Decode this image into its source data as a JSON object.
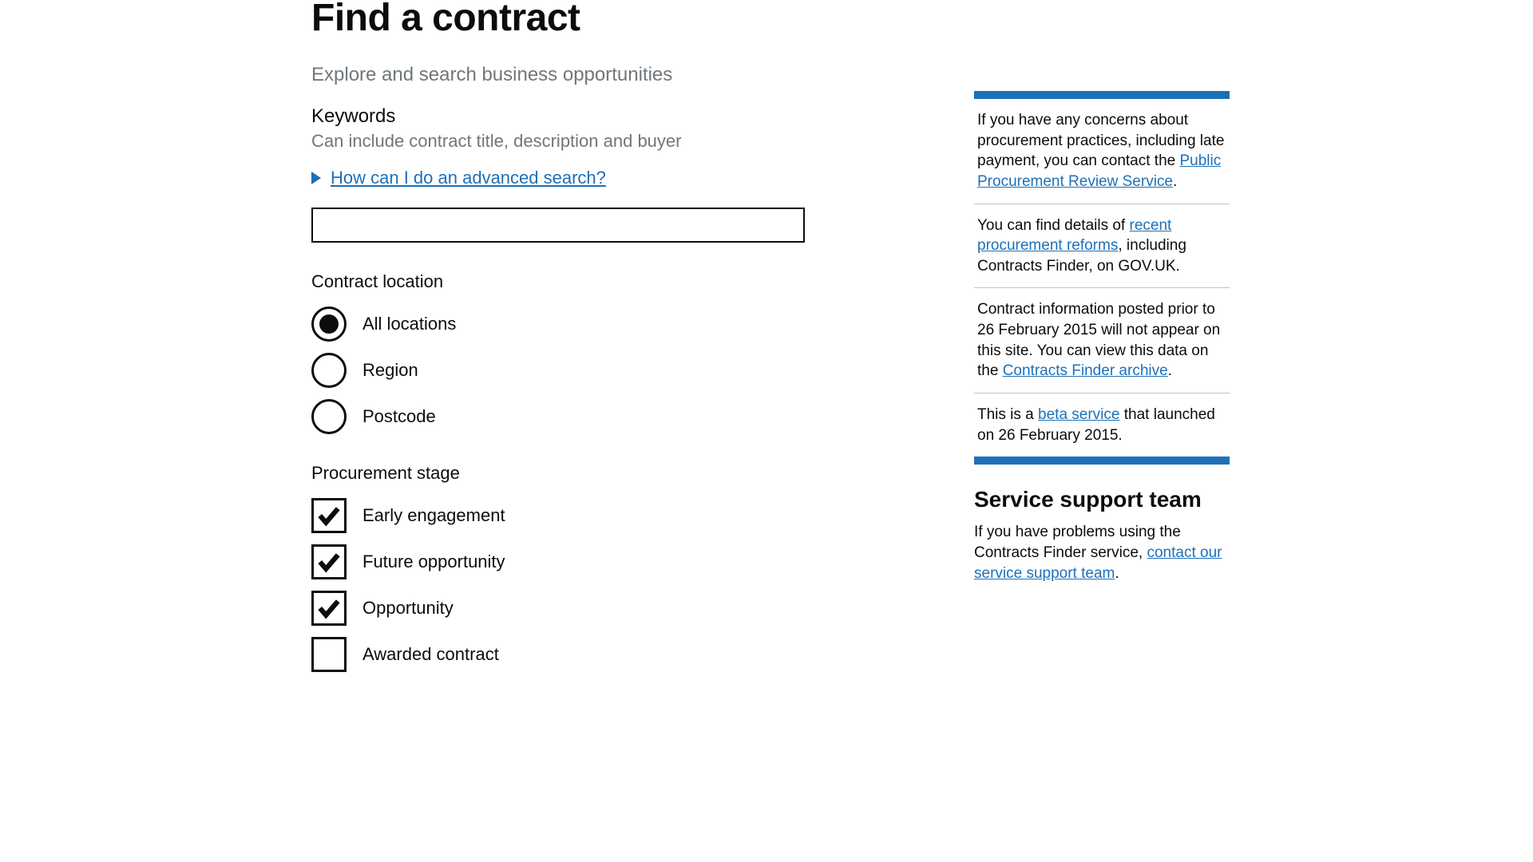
{
  "page": {
    "title": "Find a contract",
    "lede": "Explore and search business opportunities"
  },
  "keywords": {
    "label": "Keywords",
    "hint": "Can include contract title, description and buyer",
    "advanced_link": "How can I do an advanced search?",
    "value": ""
  },
  "location": {
    "legend": "Contract location",
    "options": [
      {
        "label": "All locations",
        "checked": true
      },
      {
        "label": "Region",
        "checked": false
      },
      {
        "label": "Postcode",
        "checked": false
      }
    ]
  },
  "stage": {
    "legend": "Procurement stage",
    "options": [
      {
        "label": "Early engagement",
        "checked": true
      },
      {
        "label": "Future opportunity",
        "checked": true
      },
      {
        "label": "Opportunity",
        "checked": true
      },
      {
        "label": "Awarded contract",
        "checked": false
      }
    ]
  },
  "sidebar": {
    "paras": [
      {
        "pre": "If you have any concerns about procurement practices, including late payment, you can contact the ",
        "link": "Public Procurement Review Service",
        "post": "."
      },
      {
        "pre": "You can find details of ",
        "link": "recent procurement reforms",
        "post": ", including Contracts Finder, on GOV.UK."
      },
      {
        "pre": "Contract information posted prior to 26 February 2015 will not appear on this site. You can view this data on the ",
        "link": "Contracts Finder archive",
        "post": "."
      },
      {
        "pre": "This is a ",
        "link": "beta service",
        "post": " that launched on 26 February 2015."
      }
    ]
  },
  "support": {
    "heading": "Service support team",
    "pre": "If you have problems using the Contracts Finder service, ",
    "link": "contact our service support team",
    "post": "."
  }
}
